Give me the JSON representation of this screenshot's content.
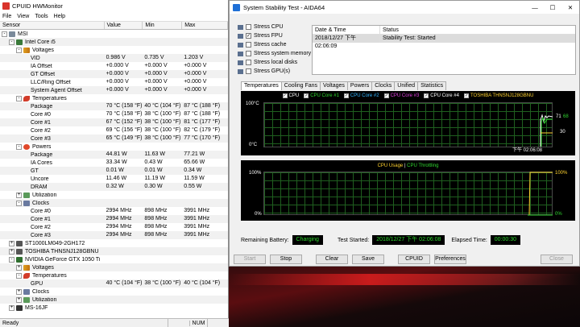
{
  "hwmonitor": {
    "title": "CPUID HWMonitor",
    "menu": [
      "File",
      "View",
      "Tools",
      "Help"
    ],
    "columns": [
      "Sensor",
      "Value",
      "Min",
      "Max"
    ],
    "rows": [
      {
        "indent": 0,
        "toggle": "-",
        "icon": "pc",
        "name": "MSI",
        "value": "",
        "min": "",
        "max": ""
      },
      {
        "indent": 1,
        "toggle": "-",
        "icon": "cpu",
        "name": "Intel Core i5",
        "value": "",
        "min": "",
        "max": ""
      },
      {
        "indent": 2,
        "toggle": "-",
        "icon": "volt",
        "name": "Voltages",
        "value": "",
        "min": "",
        "max": ""
      },
      {
        "indent": 3,
        "toggle": "",
        "icon": "",
        "name": "VID",
        "value": "0.986 V",
        "min": "0.735 V",
        "max": "1.203 V"
      },
      {
        "indent": 3,
        "toggle": "",
        "icon": "",
        "name": "IA Offset",
        "value": "+0.000 V",
        "min": "+0.000 V",
        "max": "+0.000 V"
      },
      {
        "indent": 3,
        "toggle": "",
        "icon": "",
        "name": "GT Offset",
        "value": "+0.000 V",
        "min": "+0.000 V",
        "max": "+0.000 V"
      },
      {
        "indent": 3,
        "toggle": "",
        "icon": "",
        "name": "LLC/Ring Offset",
        "value": "+0.000 V",
        "min": "+0.000 V",
        "max": "+0.000 V"
      },
      {
        "indent": 3,
        "toggle": "",
        "icon": "",
        "name": "System Agent Offset",
        "value": "+0.000 V",
        "min": "+0.000 V",
        "max": "+0.000 V"
      },
      {
        "indent": 2,
        "toggle": "-",
        "icon": "temp",
        "name": "Temperatures",
        "value": "",
        "min": "",
        "max": ""
      },
      {
        "indent": 3,
        "toggle": "",
        "icon": "",
        "name": "Package",
        "value": "70 °C (158 °F)",
        "min": "40 °C (104 °F)",
        "max": "87 °C (188 °F)"
      },
      {
        "indent": 3,
        "toggle": "",
        "icon": "",
        "name": "Core #0",
        "value": "70 °C (158 °F)",
        "min": "38 °C (100 °F)",
        "max": "87 °C (188 °F)"
      },
      {
        "indent": 3,
        "toggle": "",
        "icon": "",
        "name": "Core #1",
        "value": "67 °C (152 °F)",
        "min": "38 °C (100 °F)",
        "max": "81 °C (177 °F)"
      },
      {
        "indent": 3,
        "toggle": "",
        "icon": "",
        "name": "Core #2",
        "value": "69 °C (156 °F)",
        "min": "38 °C (100 °F)",
        "max": "82 °C (179 °F)"
      },
      {
        "indent": 3,
        "toggle": "",
        "icon": "",
        "name": "Core #3",
        "value": "65 °C (149 °F)",
        "min": "38 °C (100 °F)",
        "max": "77 °C (170 °F)"
      },
      {
        "indent": 2,
        "toggle": "-",
        "icon": "pow",
        "name": "Powers",
        "value": "",
        "min": "",
        "max": ""
      },
      {
        "indent": 3,
        "toggle": "",
        "icon": "",
        "name": "Package",
        "value": "44.81 W",
        "min": "11.63 W",
        "max": "77.21 W"
      },
      {
        "indent": 3,
        "toggle": "",
        "icon": "",
        "name": "IA Cores",
        "value": "33.34 W",
        "min": "0.43 W",
        "max": "65.66 W"
      },
      {
        "indent": 3,
        "toggle": "",
        "icon": "",
        "name": "GT",
        "value": "0.01 W",
        "min": "0.01 W",
        "max": "0.34 W"
      },
      {
        "indent": 3,
        "toggle": "",
        "icon": "",
        "name": "Uncore",
        "value": "11.46 W",
        "min": "11.19 W",
        "max": "11.59 W"
      },
      {
        "indent": 3,
        "toggle": "",
        "icon": "",
        "name": "DRAM",
        "value": "0.32 W",
        "min": "0.30 W",
        "max": "0.55 W"
      },
      {
        "indent": 2,
        "toggle": "+",
        "icon": "util",
        "name": "Utilization",
        "value": "",
        "min": "",
        "max": ""
      },
      {
        "indent": 2,
        "toggle": "-",
        "icon": "clk",
        "name": "Clocks",
        "value": "",
        "min": "",
        "max": ""
      },
      {
        "indent": 3,
        "toggle": "",
        "icon": "",
        "name": "Core #0",
        "value": "2994 MHz",
        "min": "898 MHz",
        "max": "3991 MHz"
      },
      {
        "indent": 3,
        "toggle": "",
        "icon": "",
        "name": "Core #1",
        "value": "2994 MHz",
        "min": "898 MHz",
        "max": "3991 MHz"
      },
      {
        "indent": 3,
        "toggle": "",
        "icon": "",
        "name": "Core #2",
        "value": "2994 MHz",
        "min": "898 MHz",
        "max": "3991 MHz"
      },
      {
        "indent": 3,
        "toggle": "",
        "icon": "",
        "name": "Core #3",
        "value": "2994 MHz",
        "min": "898 MHz",
        "max": "3991 MHz"
      },
      {
        "indent": 1,
        "toggle": "+",
        "icon": "hdd",
        "name": "ST1000LM049-2GH172",
        "value": "",
        "min": "",
        "max": ""
      },
      {
        "indent": 1,
        "toggle": "+",
        "icon": "hdd",
        "name": "TOSHIBA THNSNJ128GBNU",
        "value": "",
        "min": "",
        "max": ""
      },
      {
        "indent": 1,
        "toggle": "-",
        "icon": "gpu",
        "name": "NVIDIA GeForce GTX 1050 Ti",
        "value": "",
        "min": "",
        "max": ""
      },
      {
        "indent": 2,
        "toggle": "+",
        "icon": "volt",
        "name": "Voltages",
        "value": "",
        "min": "",
        "max": ""
      },
      {
        "indent": 2,
        "toggle": "-",
        "icon": "temp",
        "name": "Temperatures",
        "value": "",
        "min": "",
        "max": ""
      },
      {
        "indent": 3,
        "toggle": "",
        "icon": "",
        "name": "GPU",
        "value": "40 °C (104 °F)",
        "min": "38 °C (100 °F)",
        "max": "40 °C (104 °F)"
      },
      {
        "indent": 2,
        "toggle": "+",
        "icon": "clk",
        "name": "Clocks",
        "value": "",
        "min": "",
        "max": ""
      },
      {
        "indent": 2,
        "toggle": "+",
        "icon": "util",
        "name": "Utilization",
        "value": "",
        "min": "",
        "max": ""
      },
      {
        "indent": 1,
        "toggle": "+",
        "icon": "mb",
        "name": "MS-16JF",
        "value": "",
        "min": "",
        "max": ""
      }
    ],
    "status": {
      "ready": "Ready",
      "num": "NUM"
    }
  },
  "aida": {
    "title": "System Stability Test - AIDA64",
    "stress": [
      {
        "label": "Stress CPU",
        "checked": false
      },
      {
        "label": "Stress FPU",
        "checked": true
      },
      {
        "label": "Stress cache",
        "checked": false
      },
      {
        "label": "Stress system memory",
        "checked": false
      },
      {
        "label": "Stress local disks",
        "checked": false
      },
      {
        "label": "Stress GPU(s)",
        "checked": false
      }
    ],
    "event_headers": [
      "Date & Time",
      "Status"
    ],
    "event_row": {
      "datetime": "2018/12/27 下午 02:06:09",
      "status": "Stability Test: Started"
    },
    "tabs": [
      "Temperatures",
      "Cooling Fans",
      "Voltages",
      "Powers",
      "Clocks",
      "Unified",
      "Statistics"
    ],
    "temp_legend": [
      {
        "label": "CPU",
        "color": "#ffffff"
      },
      {
        "label": "CPU Core #1",
        "color": "#2fd62f"
      },
      {
        "label": "CPU Core #2",
        "color": "#33b5ff"
      },
      {
        "label": "CPU Core #3",
        "color": "#e040e0"
      },
      {
        "label": "CPU Core #4",
        "color": "#ffffff"
      },
      {
        "label": "TOSHIBA THNSNJ128GBNU",
        "color": "#ffd22f"
      }
    ],
    "temp_axis": {
      "top": "100°C",
      "bottom": "0°C",
      "time": "下午 02:06:08",
      "r1": "71",
      "r2": "68",
      "r3": "30"
    },
    "usage_title": {
      "a": "CPU Usage",
      "sep": "|",
      "b": "CPU Throttling"
    },
    "usage_axis": {
      "lt": "100%",
      "lb": "0%",
      "rt": "100%",
      "rb": "0%"
    },
    "bottom": {
      "battery_label": "Remaining Battery:",
      "battery_value": "Charging",
      "started_label": "Test Started:",
      "started_value": "2018/12/27 下午 02:06:08",
      "elapsed_label": "Elapsed Time:",
      "elapsed_value": "00:00:30"
    },
    "buttons": {
      "start": "Start",
      "stop": "Stop",
      "clear": "Clear",
      "save": "Save",
      "cpuid": "CPUID",
      "prefs": "Preferences",
      "close": "Close"
    }
  }
}
